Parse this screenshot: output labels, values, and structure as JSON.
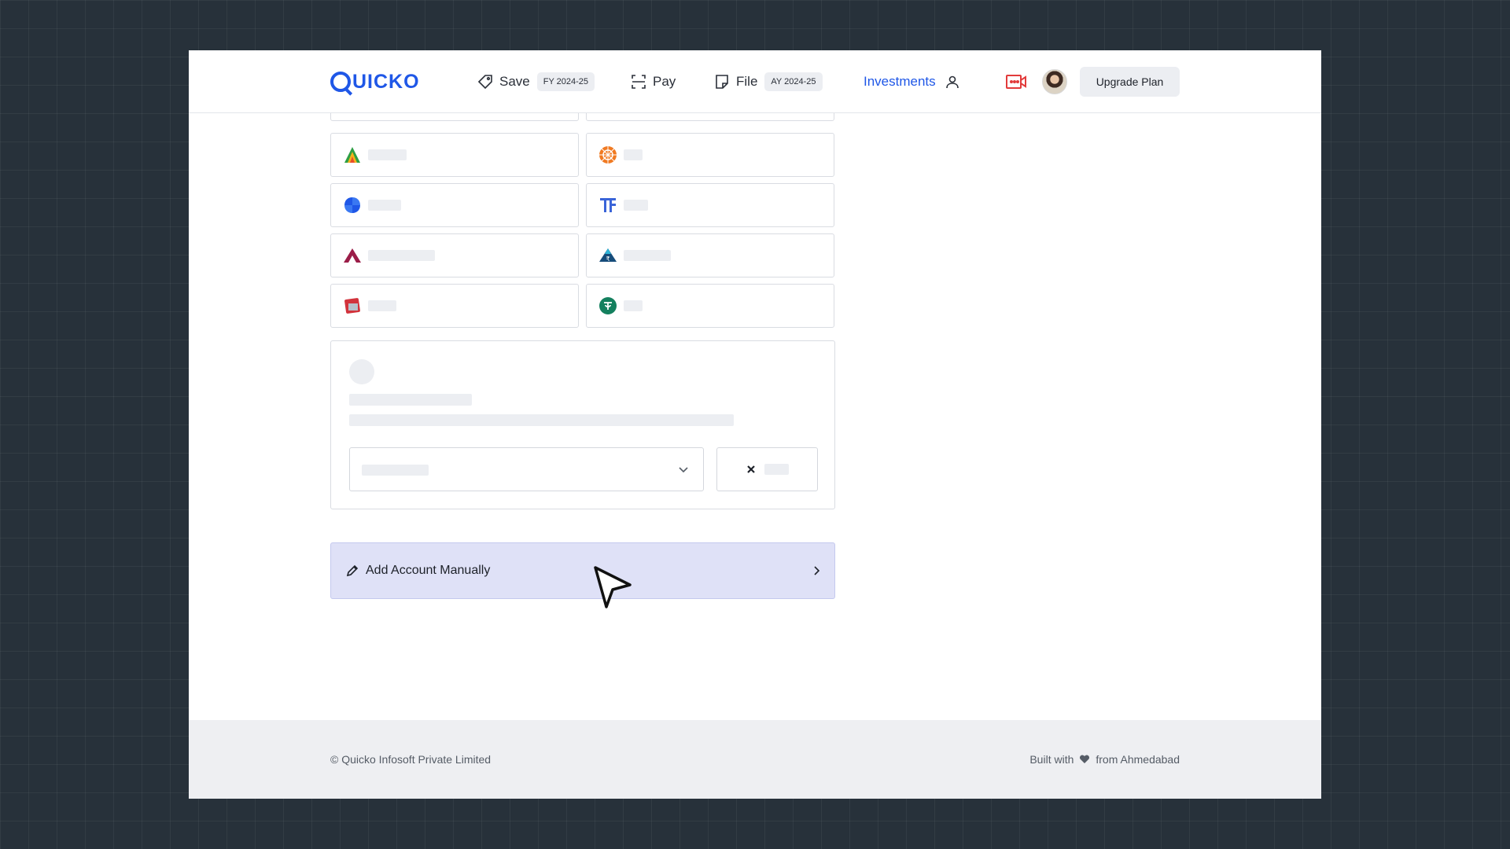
{
  "header": {
    "brand": "QUICKO",
    "nav": {
      "save": {
        "label": "Save",
        "badge": "FY 2024-25"
      },
      "pay": {
        "label": "Pay"
      },
      "file": {
        "label": "File",
        "badge": "AY 2024-25"
      },
      "investments": {
        "label": "Investments"
      }
    },
    "upgrade_label": "Upgrade Plan"
  },
  "brokers": [
    {
      "icon": "angel-one-triangle-icon",
      "color": "#2e9e44"
    },
    {
      "icon": "mandala-orange-icon",
      "color": "#f07a22"
    },
    {
      "icon": "upstox-blue-leaf-icon",
      "color": "#1f57e7"
    },
    {
      "icon": "fyers-tf-icon",
      "color": "#3a64d8"
    },
    {
      "icon": "axis-a-icon",
      "color": "#9b1d48"
    },
    {
      "icon": "rupee-mountain-icon",
      "color": "#164c7a"
    },
    {
      "icon": "red-card-icon",
      "color": "#d2333c"
    },
    {
      "icon": "dhan-green-icon",
      "color": "#14805e"
    }
  ],
  "manual": {
    "label": "Add Account Manually"
  },
  "footer": {
    "copyright": "© Quicko Infosoft Private Limited",
    "built_prefix": "Built with",
    "built_suffix": "from Ahmedabad"
  }
}
